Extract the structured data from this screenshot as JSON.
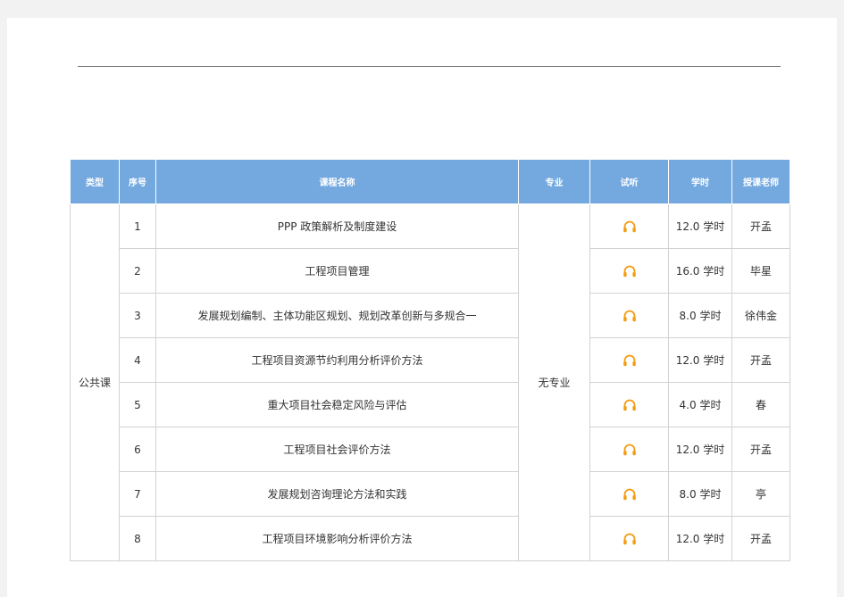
{
  "table": {
    "headers": {
      "type": "类型",
      "seq": "序号",
      "name": "课程名称",
      "major": "专业",
      "audition": "试听",
      "hours": "学时",
      "teacher": "授课老师"
    },
    "group": "公共课",
    "major": "无专业",
    "rows": [
      {
        "seq": "1",
        "name": "PPP 政策解析及制度建设",
        "hours": "12.0 学时",
        "teacher": "开孟"
      },
      {
        "seq": "2",
        "name": "工程项目管理",
        "hours": "16.0 学时",
        "teacher": "毕星"
      },
      {
        "seq": "3",
        "name": "发展规划编制、主体功能区规划、规划改革创新与多规合一",
        "hours": "8.0 学时",
        "teacher": "徐伟金"
      },
      {
        "seq": "4",
        "name": "工程项目资源节约利用分析评价方法",
        "hours": "12.0 学时",
        "teacher": "开孟"
      },
      {
        "seq": "5",
        "name": "重大项目社会稳定风险与评估",
        "hours": "4.0 学时",
        "teacher": "春"
      },
      {
        "seq": "6",
        "name": "工程项目社会评价方法",
        "hours": "12.0 学时",
        "teacher": "开孟"
      },
      {
        "seq": "7",
        "name": "发展规划咨询理论方法和实践",
        "hours": "8.0 学时",
        "teacher": "亭"
      },
      {
        "seq": "8",
        "name": "工程项目环境影响分析评价方法",
        "hours": "12.0 学时",
        "teacher": "开孟"
      }
    ]
  },
  "icon": {
    "name": "headphone-icon",
    "color": "#f39c12"
  },
  "colors": {
    "header_bg": "#73a9df",
    "header_text": "#ffffff",
    "border": "#d2d2d2"
  }
}
